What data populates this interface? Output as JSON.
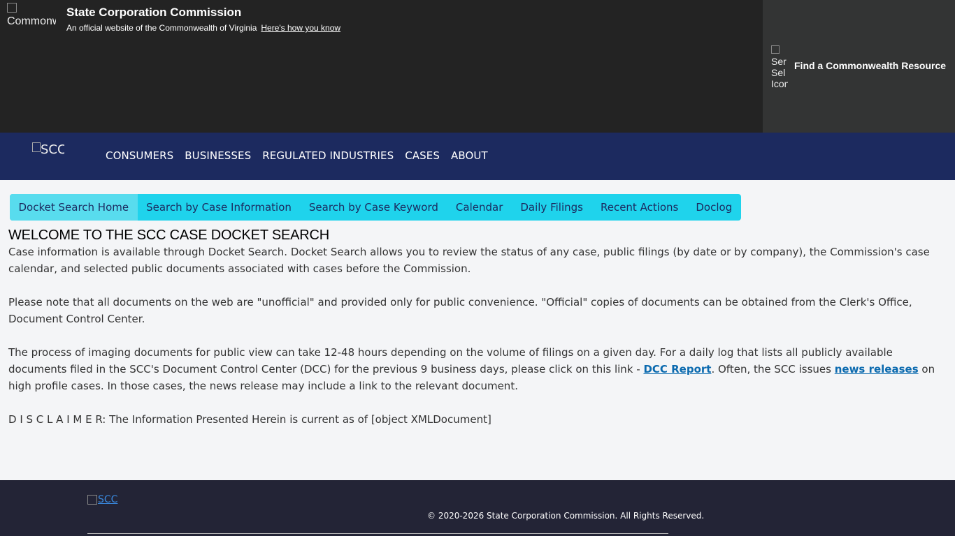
{
  "banner": {
    "seal_alt": "Commonw",
    "agency_name": "State Corporation Commission",
    "official_text": "An official website of the Commonwealth of Virginia",
    "how_link": "Here's how you know",
    "resource_icon_alt": "Ser Sel Icon",
    "resource_label": "Find a Commonwealth Resource"
  },
  "mainnav": {
    "logo_alt": "SCC",
    "items": [
      "CONSUMERS",
      "BUSINESSES",
      "REGULATED INDUSTRIES",
      "CASES",
      "ABOUT"
    ]
  },
  "subnav": {
    "tabs": [
      "Docket Search Home",
      "Search by Case Information",
      "Search by Case Keyword",
      "Calendar",
      "Daily Filings",
      "Recent Actions",
      "Doclog"
    ],
    "active": "Docket Search Home"
  },
  "content": {
    "heading": "WELCOME TO THE SCC CASE DOCKET SEARCH",
    "p1": "Case information is available through Docket Search. Docket Search allows you to review the status of any case, public filings (by date or by company), the Commission's case calendar, and selected public documents associated with cases before the Commission.",
    "p2": "Please note that all documents on the web are \"unofficial\" and provided only for public convenience. \"Official\" copies of documents can be obtained from the Clerk's Office, Document Control Center.",
    "p3_a": "The process of imaging documents for public view can take 12-48 hours depending on the volume of filings on a given day. For a daily log that lists all publicly available documents filed in the SCC's Document Control Center (DCC) for the previous 9 business days, please click on this link - ",
    "dcc_link": "DCC Report",
    "p3_b": ". Often, the SCC issues ",
    "news_link": "news releases",
    "p3_c": " on high profile cases. In those cases, the news release may include a link to the relevant document.",
    "disclaimer": "D I S C L A I M E R: The Information Presented Herein is current as of [object XMLDocument]"
  },
  "footer": {
    "logo_alt": "SCC",
    "copyright": "© 2020-2026 State Corporation Commission. All Rights Reserved."
  },
  "colors": {
    "banner_bg": "#232323",
    "nav_bg": "#1c2a5f",
    "subnav_bg": "#1fd3ec",
    "link": "#0b6aaf",
    "footer_bg": "#232436"
  }
}
